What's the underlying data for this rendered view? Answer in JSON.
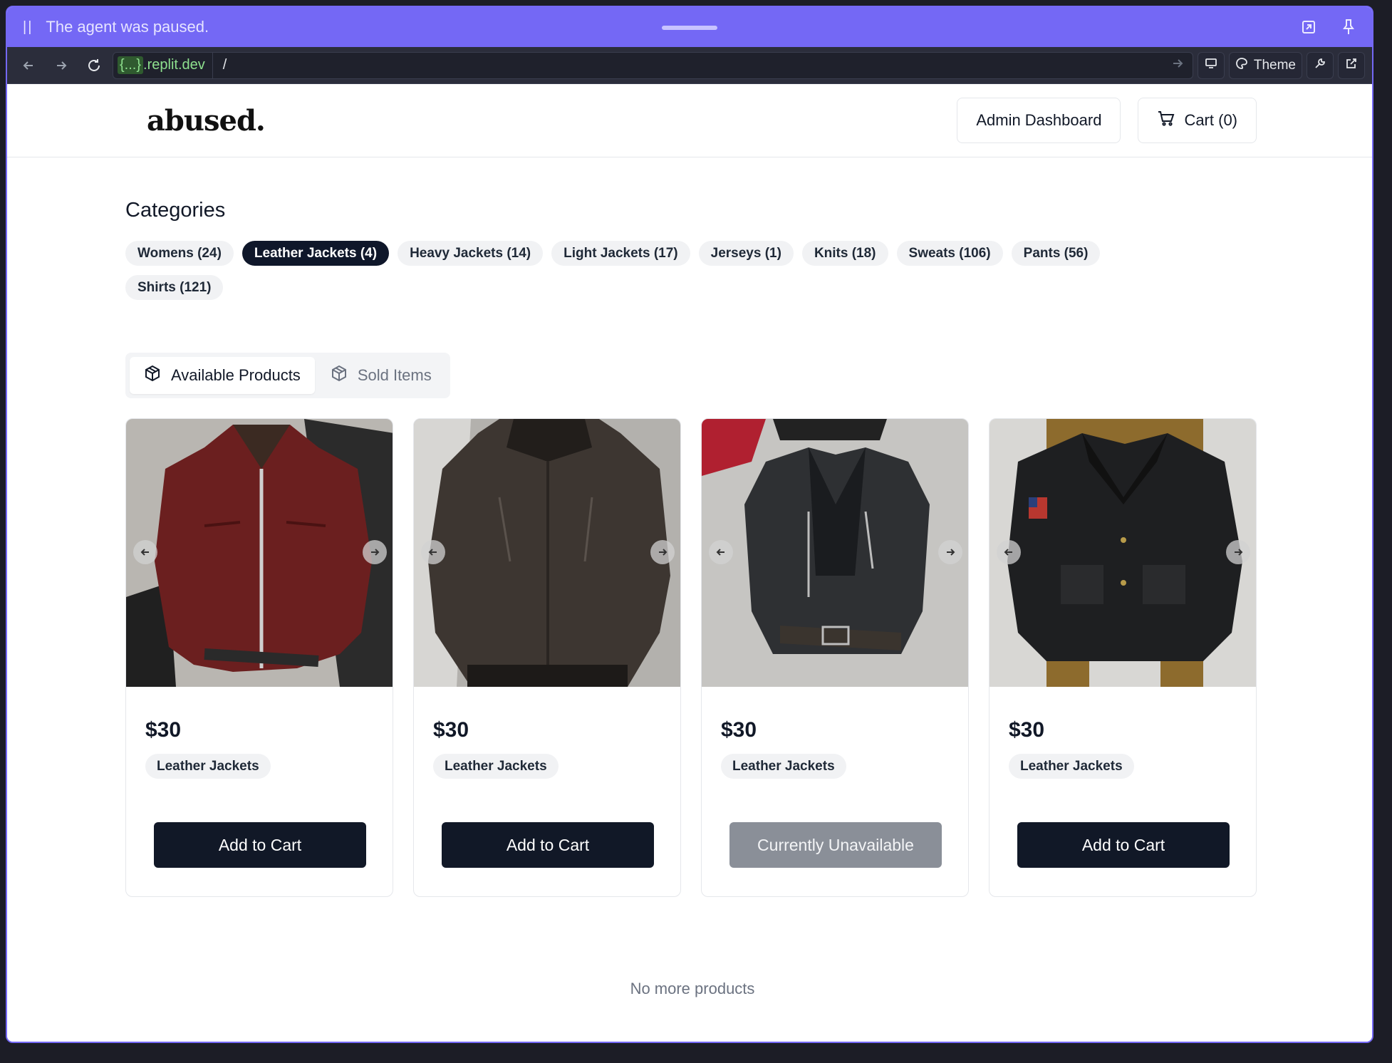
{
  "agent_bar": {
    "status": "The agent was paused."
  },
  "browser": {
    "url_highlight": "{...}",
    "url_domain": ".replit.dev",
    "url_path": "/",
    "theme_label": "Theme"
  },
  "header": {
    "logo": "abused.",
    "admin_label": "Admin Dashboard",
    "cart_label": "Cart (0)"
  },
  "categories": {
    "title": "Categories",
    "items": [
      {
        "label": "Womens (24)"
      },
      {
        "label": "Leather Jackets (4)"
      },
      {
        "label": "Heavy Jackets (14)"
      },
      {
        "label": "Light Jackets (17)"
      },
      {
        "label": "Jerseys (1)"
      },
      {
        "label": "Knits (18)"
      },
      {
        "label": "Sweats (106)"
      },
      {
        "label": "Pants (56)"
      },
      {
        "label": "Shirts (121)"
      }
    ],
    "active_index": 1
  },
  "tabs": {
    "available": "Available Products",
    "sold": "Sold Items"
  },
  "products": [
    {
      "price": "$30",
      "category": "Leather Jackets",
      "action": "Add to Cart",
      "available": true
    },
    {
      "price": "$30",
      "category": "Leather Jackets",
      "action": "Add to Cart",
      "available": true
    },
    {
      "price": "$30",
      "category": "Leather Jackets",
      "action": "Currently Unavailable",
      "available": false
    },
    {
      "price": "$30",
      "category": "Leather Jackets",
      "action": "Add to Cart",
      "available": true
    }
  ],
  "footer": {
    "message": "No more products"
  },
  "colors": {
    "accent": "#7468f5",
    "primary_button": "#111827",
    "disabled_button": "#8a8f98"
  }
}
